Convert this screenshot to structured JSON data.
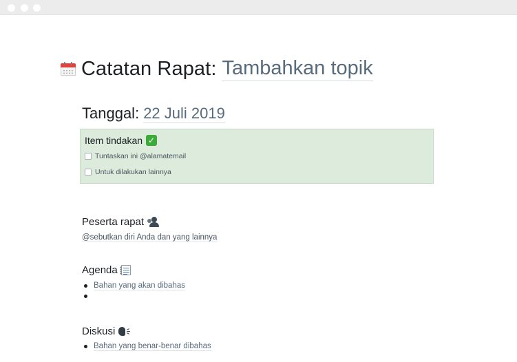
{
  "window": {
    "controls": [
      "close",
      "minimize",
      "zoom"
    ]
  },
  "title": {
    "icon": "calendar-icon",
    "static": "Catatan Rapat:",
    "link": "Tambahkan topik"
  },
  "date": {
    "static": "Tanggal:",
    "link": "22 Juli 2019"
  },
  "action_items": {
    "title": "Item tindakan",
    "icon": "check-mark-icon",
    "items": [
      {
        "label": "Tuntaskan ini @alamatemail",
        "checked": false
      },
      {
        "label": "Untuk dilakukan lainnya",
        "checked": false
      }
    ],
    "background": "#dcebdb"
  },
  "attendees": {
    "heading": "Peserta rapat",
    "icon": "people-icon",
    "placeholder": "@sebutkan diri Anda dan yang lainnya"
  },
  "agenda": {
    "heading": "Agenda",
    "icon": "notes-icon",
    "items": [
      "Bahan yang akan dibahas",
      ""
    ]
  },
  "discussion": {
    "heading": "Diskusi",
    "icon": "speaking-head-icon",
    "items": [
      "Bahan yang benar-benar dibahas"
    ]
  },
  "colors": {
    "link_text": "#586b7d",
    "body_text": "#1c2024",
    "check_green": "#3cab3a",
    "calendar_red": "#e0413a"
  }
}
